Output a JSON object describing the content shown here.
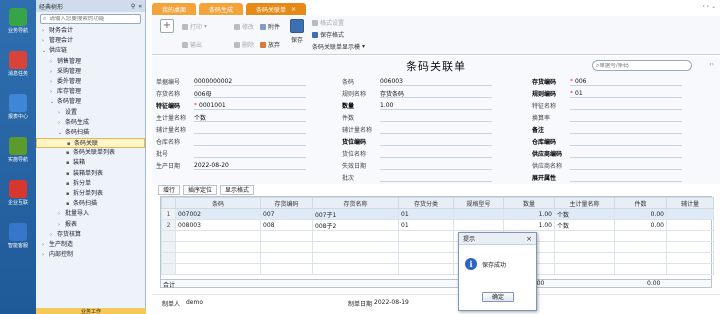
{
  "rail": [
    {
      "label": "业务导航",
      "color": "#37a447"
    },
    {
      "label": "消息任务",
      "color": "#d9433a"
    },
    {
      "label": "报表中心",
      "color": "#3e86d6"
    },
    {
      "label": "实施导航",
      "color": "#5b9b2e"
    },
    {
      "label": "企业互联",
      "color": "#d6372f"
    },
    {
      "label": "智能客服",
      "color": "#3677cc"
    }
  ],
  "nav": {
    "header": "经典树形",
    "search_placeholder": "请输入您要搜索的功能",
    "items": [
      {
        "label": "财务会计",
        "caret": "›",
        "indent": 1
      },
      {
        "label": "管理会计",
        "caret": "›",
        "indent": 1
      },
      {
        "label": "供应链",
        "caret": "⌄",
        "indent": 1
      },
      {
        "label": "销售管理",
        "caret": "›",
        "indent": 2
      },
      {
        "label": "采购管理",
        "caret": "›",
        "indent": 2
      },
      {
        "label": "委外管理",
        "caret": "›",
        "indent": 2
      },
      {
        "label": "库存管理",
        "caret": "›",
        "indent": 2
      },
      {
        "label": "条码管理",
        "caret": "⌄",
        "indent": 2
      },
      {
        "label": "设置",
        "caret": "›",
        "indent": 3
      },
      {
        "label": "条码生成",
        "caret": "›",
        "indent": 3
      },
      {
        "label": "条码扫描",
        "caret": "⌄",
        "indent": 3
      },
      {
        "label": "条码关联",
        "caret": "▪",
        "indent": 4,
        "selected": true
      },
      {
        "label": "条码关联单列表",
        "caret": "▪",
        "indent": 4
      },
      {
        "label": "装箱",
        "caret": "▪",
        "indent": 4
      },
      {
        "label": "装箱单列表",
        "caret": "▪",
        "indent": 4
      },
      {
        "label": "拆分单",
        "caret": "▪",
        "indent": 4
      },
      {
        "label": "拆分单列表",
        "caret": "▪",
        "indent": 4
      },
      {
        "label": "条码扫描",
        "caret": "▪",
        "indent": 4
      },
      {
        "label": "批量导入",
        "caret": "›",
        "indent": 3
      },
      {
        "label": "报表",
        "caret": "›",
        "indent": 3
      },
      {
        "label": "存货核算",
        "caret": "›",
        "indent": 2
      },
      {
        "label": "生产制造",
        "caret": "›",
        "indent": 1
      },
      {
        "label": "内部控制",
        "caret": "›",
        "indent": 1
      }
    ],
    "footer": "业务工作"
  },
  "tabs": [
    {
      "label": "我的桌面",
      "active": false
    },
    {
      "label": "条码生成",
      "active": false
    },
    {
      "label": "条码关联单",
      "active": true
    }
  ],
  "toolbar": {
    "add": "",
    "print": "打印",
    "output": "输出",
    "edit": "修改",
    "delete": "删除",
    "attach": "附件",
    "abandon": "放弃",
    "save": "保存",
    "format_setting": "格式设置",
    "save_format": "保存格式",
    "display_template": "条码关联单显示模"
  },
  "form": {
    "title": "条码关联单",
    "search_placeholder": "单据号/条码",
    "fields": {
      "doc_no": {
        "label": "单据编号",
        "value": "0000000002"
      },
      "barcode": {
        "label": "条码",
        "value": "006003"
      },
      "inv_code": {
        "label": "存货编码",
        "value": "006",
        "required": true
      },
      "inv_name": {
        "label": "存货名称",
        "value": "006母"
      },
      "spec_name": {
        "label": "规则名称",
        "value": "存货条码"
      },
      "spec_code": {
        "label": "规则编码",
        "value": "01",
        "required": true
      },
      "trace_code": {
        "label": "特征编码",
        "value": "0001001",
        "required": true
      },
      "quantity": {
        "label": "数量",
        "value": "1.00"
      },
      "trace_name": {
        "label": "特征名称",
        "value": ""
      },
      "main_unit": {
        "label": "主计量名称",
        "value": "个数"
      },
      "pieces": {
        "label": "件数",
        "value": ""
      },
      "conv_rate": {
        "label": "换算率",
        "value": ""
      },
      "aux_unit": {
        "label": "辅计量名称",
        "value": ""
      },
      "aux_qty": {
        "label": "辅计量名称",
        "value": ""
      },
      "remark": {
        "label": "备注",
        "value": ""
      },
      "warehouse": {
        "label": "仓库名称",
        "value": ""
      },
      "loc_code": {
        "label": "货位编码",
        "value": ""
      },
      "wh_code": {
        "label": "仓库编码",
        "value": ""
      },
      "batch": {
        "label": "批号",
        "value": ""
      },
      "loc_name": {
        "label": "货位名称",
        "value": ""
      },
      "supplier_code": {
        "label": "供应商编码",
        "value": ""
      },
      "prod_date": {
        "label": "生产日期",
        "value": "2022-08-20"
      },
      "valid_date": {
        "label": "失效日期",
        "value": ""
      },
      "supplier_name": {
        "label": "供应商名称",
        "value": ""
      },
      "batch_no": {
        "label": "批次",
        "value": ""
      },
      "expand": {
        "label": "展开属性",
        "value": ""
      }
    }
  },
  "grid": {
    "tools": [
      "增行",
      "插序定位",
      "显示格式"
    ],
    "columns": [
      "",
      "条码",
      "存货编码",
      "存货名称",
      "存货分类",
      "规格型号",
      "数量",
      "主计量名称",
      "件数",
      "辅计量"
    ],
    "rows": [
      [
        "1",
        "007002",
        "007",
        "007子1",
        "01",
        "",
        "1.00",
        "个数",
        "0.00",
        ""
      ],
      [
        "2",
        "008003",
        "008",
        "008子2",
        "01",
        "",
        "1.00",
        "个数",
        "0.00",
        ""
      ],
      [
        "",
        "",
        "",
        "",
        "",
        "",
        "",
        "",
        "",
        ""
      ],
      [
        "",
        "",
        "",
        "",
        "",
        "",
        "",
        "",
        "",
        ""
      ],
      [
        "",
        "",
        "",
        "",
        "",
        "",
        "",
        "",
        "",
        ""
      ],
      [
        "",
        "",
        "",
        "",
        "",
        "",
        "",
        "",
        "",
        ""
      ]
    ],
    "sum_label": "合计",
    "sum_qty": "2.00",
    "sum_pieces": "0.00"
  },
  "footer": {
    "maker_label": "制单人",
    "maker": "demo",
    "date_label": "制单日期",
    "date": "2022-08-19"
  },
  "dialog": {
    "title": "提示",
    "message": "保存成功",
    "ok": "确定"
  }
}
